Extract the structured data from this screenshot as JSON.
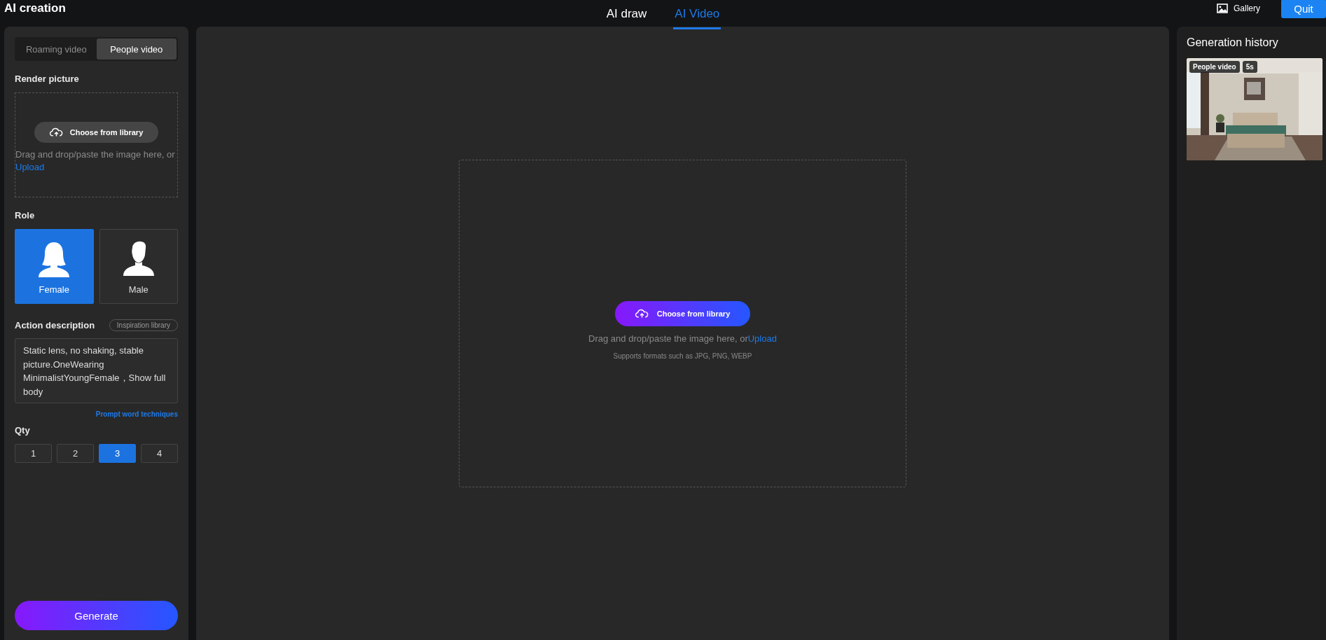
{
  "app_title": "AI creation",
  "nav_tabs": [
    {
      "label": "AI draw",
      "selected": false
    },
    {
      "label": "AI Video",
      "selected": true
    }
  ],
  "header_actions": {
    "gallery": "Gallery",
    "quit": "Quit"
  },
  "mode_tabs": [
    {
      "label": "Roaming video",
      "selected": false
    },
    {
      "label": "People video",
      "selected": true
    }
  ],
  "render_picture": {
    "label": "Render picture",
    "button": "Choose from library",
    "hint": "Drag and drop/paste the image here, or",
    "link": "Upload"
  },
  "role": {
    "label": "Role",
    "options": [
      {
        "label": "Female",
        "kind": "female",
        "selected": true
      },
      {
        "label": "Male",
        "kind": "male",
        "selected": false
      }
    ]
  },
  "action_description": {
    "label": "Action description",
    "library_button": "Inspiration library",
    "value": "Static lens, no shaking, stable picture.OneWearing MinimalistYoungFemale，Show full body",
    "tips_link": "Prompt word techniques"
  },
  "qty": {
    "label": "Qty",
    "options": [
      {
        "label": "1",
        "selected": false
      },
      {
        "label": "2",
        "selected": false
      },
      {
        "label": "3",
        "selected": true
      },
      {
        "label": "4",
        "selected": false
      }
    ]
  },
  "generate_button": "Generate",
  "upload_area": {
    "button": "Choose from library",
    "hint": "Drag and drop/paste the image here, or",
    "link": "Upload",
    "formats": "Supports formats such as JPG, PNG, WEBP"
  },
  "history": {
    "title": "Generation history",
    "items": [
      {
        "kind": "picture",
        "type_tag": "People video",
        "duration": "5s"
      }
    ]
  }
}
